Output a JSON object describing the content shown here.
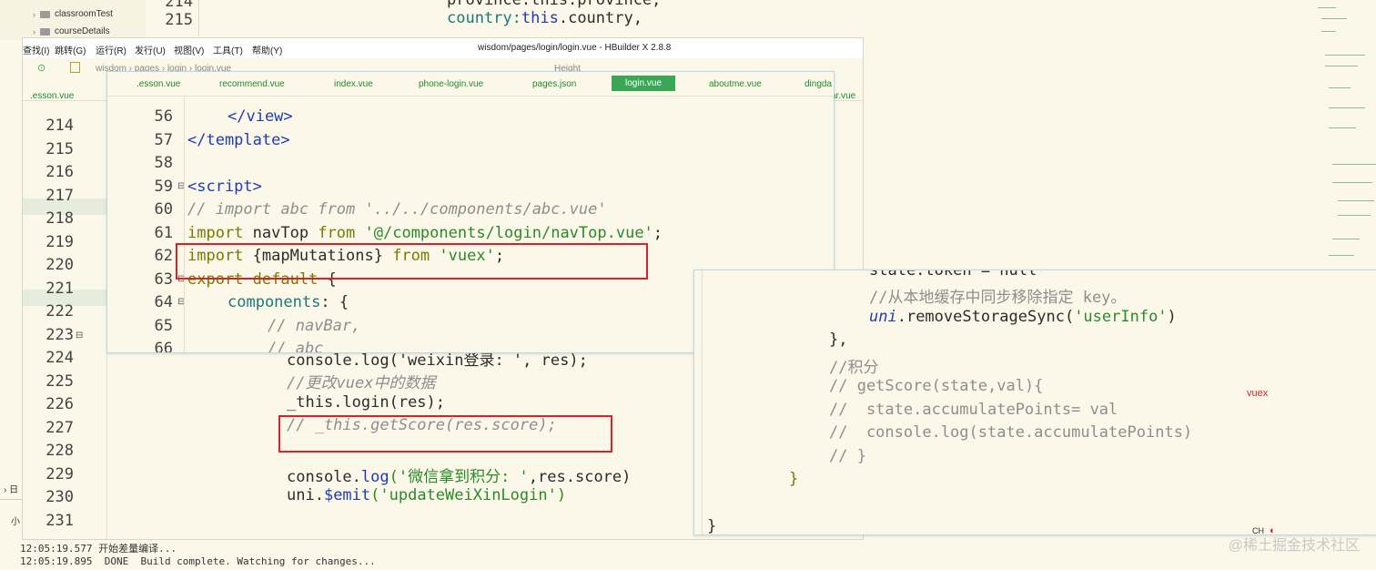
{
  "file_tree": [
    {
      "label": "classroomTest"
    },
    {
      "label": "courseDetails"
    }
  ],
  "bg_editor": {
    "line_numbers": [
      "214",
      "215"
    ],
    "code_lines": [
      "province:this.province,",
      "country:this.country,"
    ]
  },
  "window": {
    "menus": [
      "查找(I)",
      "跳转(G)",
      "运行(R)",
      "发行(U)",
      "视图(V)",
      "工具(T)",
      "帮助(Y)"
    ],
    "title": "wisdom/pages/login/login.vue - HBuilder X 2.8.8",
    "breadcrumb": [
      "wisdom",
      "pages",
      "login",
      "login.vue",
      "Height"
    ],
    "back_tabs": [
      ".esson.vue",
      "ar.vue"
    ],
    "side_labels": [
      "ent",
      "nt"
    ]
  },
  "back_editor": {
    "line_numbers": [
      "214",
      "215",
      "216",
      "217",
      "218",
      "219",
      "220",
      "221",
      "222",
      "223",
      "224",
      "225",
      "226",
      "227",
      "228",
      "229",
      "230",
      "231"
    ],
    "lines": {
      "l224": "console.log('weixin登录: ', res);",
      "l225": "//更改vuex中的数据",
      "l226a": "_this",
      "l226b": ".login(res);",
      "l227": "// _this.getScore(res.score);",
      "l229a": "console.",
      "l229b": "log",
      "l229c": "('微信拿到积分: '",
      "l229d": ",res.score)",
      "l230a": "uni.",
      "l230b": "$emit",
      "l230c": "('updateWeiXinLogin')"
    }
  },
  "front_editor": {
    "tabs": [
      ".esson.vue",
      "recommend.vue",
      "index.vue",
      "phone-login.vue",
      "pages.json",
      "login.vue",
      "aboutme.vue",
      "dingda"
    ],
    "active_tab": "login.vue",
    "line_numbers": [
      "56",
      "57",
      "58",
      "59",
      "60",
      "61",
      "62",
      "63",
      "64",
      "65",
      "66"
    ],
    "lines": {
      "l56": "</view>",
      "l57": "</template>",
      "l59": "<script>",
      "l60": "// import abc from '../../components/abc.vue'",
      "l61a": "import",
      "l61b": " navTop ",
      "l61c": "from",
      "l61d": "'@/components/login/navTop.vue'",
      "l61e": ";",
      "l62a": "import",
      "l62b": " {mapMutations} ",
      "l62c": "from",
      "l62d": "'vuex'",
      "l62e": ";",
      "l63a": "export default",
      "l63b": " {",
      "l64a": "components",
      "l64b": ": {",
      "l65": "// navBar,",
      "l66": "// abc"
    }
  },
  "store_editor": {
    "lines": {
      "r0": "state.token = null",
      "r1": "//从本地缓存中同步移除指定 key。",
      "r2a": "uni",
      "r2b": ".removeStorageSync(",
      "r2c": "'userInfo'",
      "r2d": ")",
      "r3": "},",
      "r4": "//积分",
      "r5": "// getScore(state,val){",
      "r6": "//  state.accumulatePoints= val",
      "r7": "//  console.log(state.accumulatePoints)",
      "r8": "// }",
      "r9": "}",
      "r10": "}"
    }
  },
  "annotation": "vuex",
  "console": [
    "12:05:19.577 开始差量编译...",
    "12:05:19.895  DONE  Build complete. Watching for changes..."
  ],
  "watermark": "@稀土掘金技术社区",
  "bottom_left": [
    "日",
    "小"
  ],
  "colors": {
    "background": "#fbf8e9",
    "active_tab": "#3aa757",
    "highlight_box": "#d8222a",
    "keyword": "#7a7a00",
    "string": "#2a8a2a",
    "tag": "#1f3cb0"
  }
}
